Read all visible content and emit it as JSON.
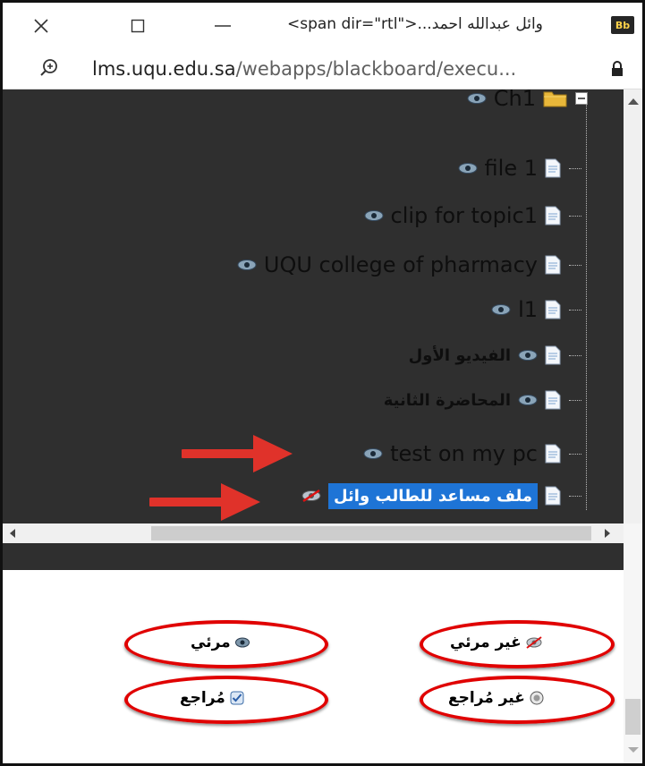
{
  "window": {
    "title": "<span dir=\"rtl\">...وائل عبدالله احمد",
    "app_logo": "Bb",
    "close_icon": "close-icon",
    "maximize_icon": "maximize-icon",
    "minimize_icon": "minimize-icon"
  },
  "address_bar": {
    "domain": "lms.uqu.edu.sa",
    "path": "/webapps/blackboard/execu...",
    "zoom_icon": "zoom-icon",
    "lock_icon": "lock-icon"
  },
  "tree": {
    "items": [
      {
        "label": "Ch1",
        "icon": "folder-icon",
        "visible": true
      },
      {
        "label": "file 1",
        "icon": "document-icon",
        "visible": true
      },
      {
        "label": "clip for topic1",
        "icon": "document-icon",
        "visible": true
      },
      {
        "label": "UQU college of pharmacy",
        "icon": "document-icon",
        "visible": true
      },
      {
        "label": "l1",
        "icon": "document-icon",
        "visible": true
      },
      {
        "label": "الفيديو الأول",
        "icon": "document-icon",
        "visible": true
      },
      {
        "label": "المحاضرة الثانية",
        "icon": "document-icon",
        "visible": true
      },
      {
        "label": "test on my pc",
        "icon": "document-icon",
        "visible": true
      },
      {
        "label": "ملف مساعد للطالب وائل",
        "icon": "document-icon",
        "visible": false,
        "selected": true
      }
    ]
  },
  "legend": {
    "visible_label": "مرئي",
    "not_visible_label": "غير مرئي",
    "reviewed_label": "مُراجع",
    "not_reviewed_label": "غير مُراجع"
  },
  "colors": {
    "tree_background": "#2f2f2f",
    "selection": "#1e74d6",
    "annotation_red": "#e00000"
  }
}
